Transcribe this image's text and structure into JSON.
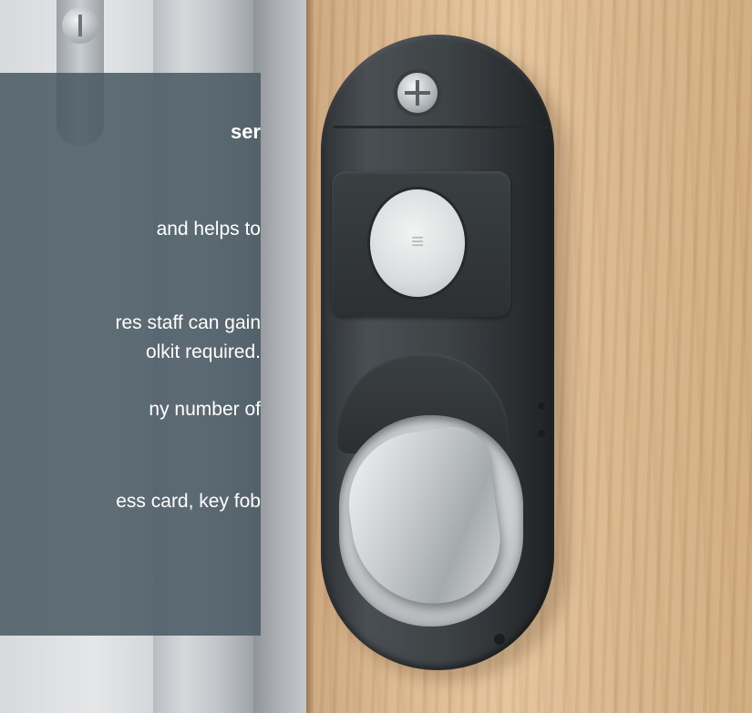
{
  "overlay": {
    "title": "ser",
    "lines": [
      "and helps to",
      "res staff can gain",
      "olkit required.",
      "ny number of",
      "ess card, key fob"
    ]
  },
  "icons": {
    "contactless": "contactless-icon"
  }
}
